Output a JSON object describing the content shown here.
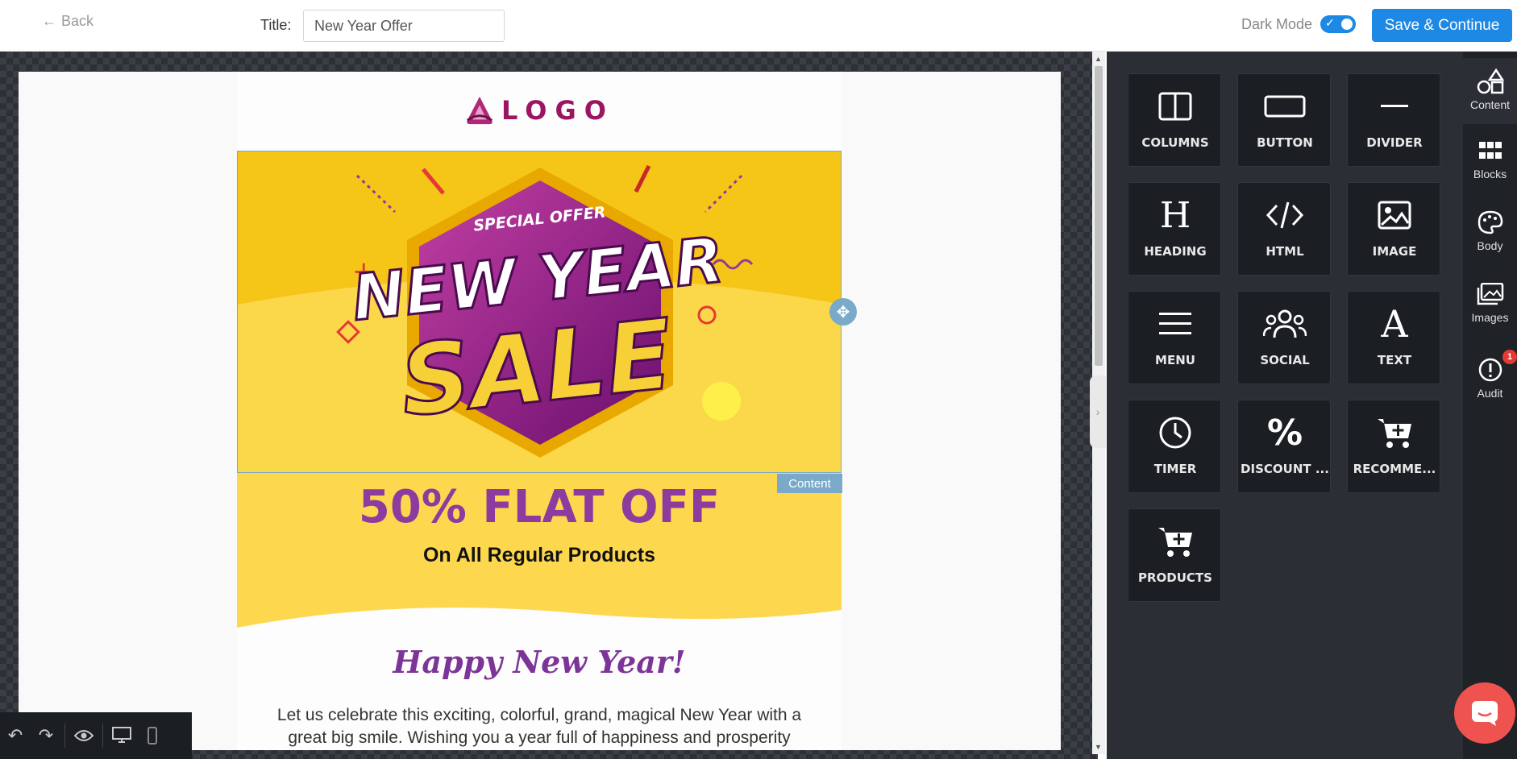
{
  "topbar": {
    "back_label": "Back",
    "title_label": "Title:",
    "title_value": "New Year Offer",
    "dark_mode_label": "Dark Mode",
    "dark_mode_on": true,
    "save_label": "Save & Continue"
  },
  "email": {
    "logo_text": "LOGO",
    "hero": {
      "kicker": "SPECIAL OFFER",
      "line1": "NEW YEAR",
      "line2": "SALE"
    },
    "selection_tag": "Content",
    "headline": "50% FLAT OFF",
    "subheadline": "On All Regular Products",
    "greeting": "Happy New Year!",
    "body": "Let us celebrate this exciting, colorful, grand, magical New Year with a great big smile. Wishing you a year full of happiness and prosperity"
  },
  "content_tiles": [
    {
      "label": "COLUMNS",
      "icon": "columns-icon"
    },
    {
      "label": "BUTTON",
      "icon": "button-icon"
    },
    {
      "label": "DIVIDER",
      "icon": "divider-icon"
    },
    {
      "label": "HEADING",
      "icon": "heading-icon"
    },
    {
      "label": "HTML",
      "icon": "code-icon"
    },
    {
      "label": "IMAGE",
      "icon": "image-icon"
    },
    {
      "label": "MENU",
      "icon": "menu-icon"
    },
    {
      "label": "SOCIAL",
      "icon": "users-icon"
    },
    {
      "label": "TEXT",
      "icon": "text-icon"
    },
    {
      "label": "TIMER",
      "icon": "clock-icon"
    },
    {
      "label": "DISCOUNT ...",
      "icon": "percent-icon"
    },
    {
      "label": "RECOMME...",
      "icon": "cart-plus-icon"
    },
    {
      "label": "PRODUCTS",
      "icon": "cart-plus-icon"
    }
  ],
  "rail_tabs": [
    {
      "label": "Content",
      "icon": "shapes-icon",
      "active": true
    },
    {
      "label": "Blocks",
      "icon": "grid-icon"
    },
    {
      "label": "Body",
      "icon": "palette-icon"
    },
    {
      "label": "Images",
      "icon": "images-icon"
    },
    {
      "label": "Audit",
      "icon": "alert-icon",
      "badge": "1"
    }
  ],
  "colors": {
    "accent": "#1e88e5",
    "panel": "#2b2f35",
    "headline": "#8e3ba0",
    "hero_yellow": "#f5c518",
    "selection": "#7aa9c9",
    "chat": "#ef5350"
  }
}
